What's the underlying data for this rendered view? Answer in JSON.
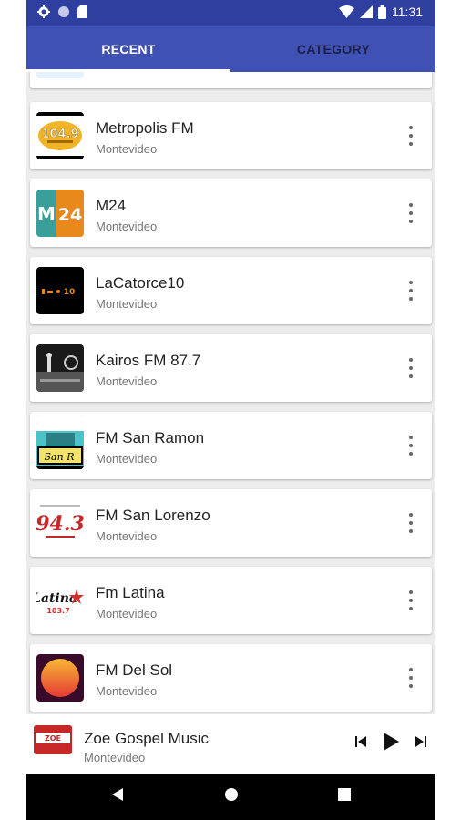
{
  "status_bar": {
    "time": "11:31",
    "left_icons": [
      "gear-icon",
      "circle-icon",
      "sim-icon"
    ],
    "right_icons": [
      "wifi-icon",
      "signal-icon",
      "battery-icon"
    ]
  },
  "tabs": [
    {
      "label": "RECENT",
      "active": true
    },
    {
      "label": "CATEGORY",
      "active": false
    }
  ],
  "colors": {
    "tab_bar": "#3f51b5",
    "status_bar": "#2f3fa0",
    "background": "#ececec"
  },
  "stations": [
    {
      "name": "Metropolis FM",
      "city": "Montevideo",
      "logo": "metropolis-logo"
    },
    {
      "name": "M24",
      "city": "Montevideo",
      "logo": "m24-logo"
    },
    {
      "name": "LaCatorce10",
      "city": "Montevideo",
      "logo": "lacatorce10-logo"
    },
    {
      "name": "Kairos FM 87.7",
      "city": "Montevideo",
      "logo": "kairos-logo"
    },
    {
      "name": "FM San Ramon",
      "city": "Montevideo",
      "logo": "san-ramon-logo"
    },
    {
      "name": "FM San Lorenzo",
      "city": "Montevideo",
      "logo": "san-lorenzo-logo"
    },
    {
      "name": "Fm Latina",
      "city": "Montevideo",
      "logo": "latina-logo"
    },
    {
      "name": "FM Del Sol",
      "city": "Montevideo",
      "logo": "del-sol-logo"
    }
  ],
  "now_playing": {
    "title": "Zoe Gospel Music",
    "subtitle": "Montevideo",
    "controls": [
      "skip-previous-icon",
      "play-icon",
      "skip-next-icon"
    ]
  },
  "nav_bar": [
    "back-icon",
    "home-icon",
    "recents-icon"
  ]
}
